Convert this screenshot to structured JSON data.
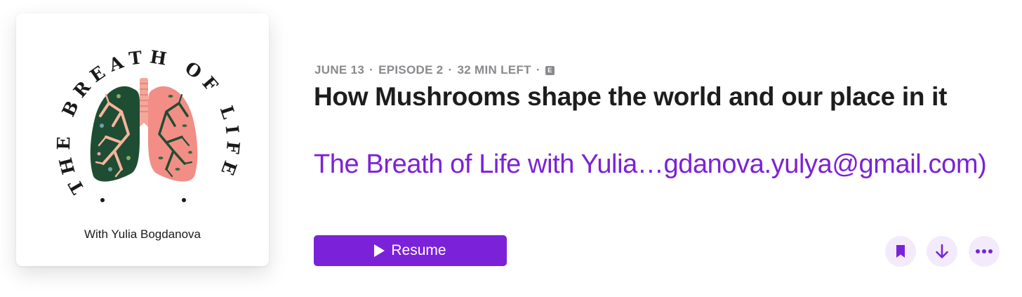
{
  "artwork": {
    "arc_title": "THE BREATH OF LIFE",
    "subtitle": "With Yulia Bogdanova",
    "colors": {
      "lung_dark": "#1f4d33",
      "lung_pink": "#f28e86",
      "trachea": "#f4a79a",
      "branches": "#f6b59c"
    }
  },
  "episode": {
    "date": "JUNE 13",
    "number": "EPISODE 2",
    "time_left": "32 MIN LEFT",
    "separator": "·",
    "explicit_badge": "E",
    "title": "How Mushrooms shape the world and our place in it",
    "show_name": "The Breath of Life with Yulia…gdanova.yulya@gmail.com)"
  },
  "actions": {
    "resume_label": "Resume",
    "bookmark_icon": "bookmark-icon",
    "download_icon": "download-arrow-icon",
    "more_icon": "more-ellipsis-icon"
  },
  "theme": {
    "accent": "#7b22d9",
    "accent_light": "#f3ebfb",
    "meta_gray": "#8a8a8e",
    "title_color": "#1d1d1f"
  }
}
